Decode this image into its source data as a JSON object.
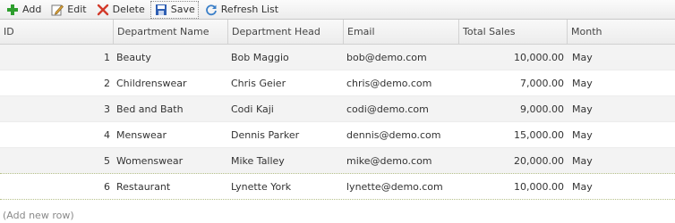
{
  "toolbar": {
    "buttons": [
      {
        "label": "Add",
        "icon": "plus-icon"
      },
      {
        "label": "Edit",
        "icon": "pencil-icon"
      },
      {
        "label": "Delete",
        "icon": "x-icon"
      },
      {
        "label": "Save",
        "icon": "floppy-disk-icon",
        "active": true
      },
      {
        "label": "Refresh List",
        "icon": "refresh-icon"
      }
    ]
  },
  "grid": {
    "columns": [
      "ID",
      "Department Name",
      "Department Head",
      "Email",
      "Total Sales",
      "Month"
    ],
    "rows": [
      {
        "id": "1",
        "department": "Beauty",
        "head": "Bob Maggio",
        "email": "bob@demo.com",
        "sales": "10,000.00",
        "month": "May"
      },
      {
        "id": "2",
        "department": "Childrenswear",
        "head": "Chris Geier",
        "email": "chris@demo.com",
        "sales": "7,000.00",
        "month": "May"
      },
      {
        "id": "3",
        "department": "Bed and Bath",
        "head": "Codi Kaji",
        "email": "codi@demo.com",
        "sales": "9,000.00",
        "month": "May"
      },
      {
        "id": "4",
        "department": "Menswear",
        "head": "Dennis Parker",
        "email": "dennis@demo.com",
        "sales": "15,000.00",
        "month": "May"
      },
      {
        "id": "5",
        "department": "Womenswear",
        "head": "Mike Talley",
        "email": "mike@demo.com",
        "sales": "20,000.00",
        "month": "May"
      },
      {
        "id": "6",
        "department": "Restaurant",
        "head": "Lynette York",
        "email": "lynette@demo.com",
        "sales": "10,000.00",
        "month": "May"
      }
    ],
    "add_new_row": "(Add new row)"
  },
  "colors": {
    "add_icon": "#2e9e2e",
    "delete_icon": "#d23a2a",
    "save_icon": "#2f5fb3",
    "refresh_icon": "#3a7fc8"
  }
}
